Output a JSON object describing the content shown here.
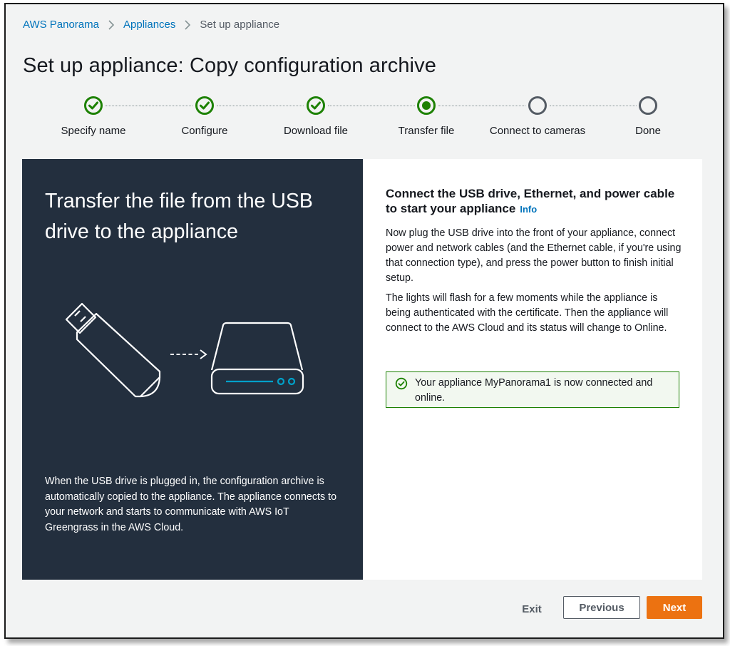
{
  "breadcrumb": {
    "items": [
      {
        "label": "AWS Panorama",
        "link": true
      },
      {
        "label": "Appliances",
        "link": true
      },
      {
        "label": "Set up appliance",
        "link": false
      }
    ],
    "separator_icon": "chevron-right-icon"
  },
  "page": {
    "title": "Set up appliance: Copy configuration archive"
  },
  "steps": [
    {
      "label": "Specify name",
      "status": "completed",
      "icon": "check-circle-icon"
    },
    {
      "label": "Configure",
      "status": "completed",
      "icon": "check-circle-icon"
    },
    {
      "label": "Download file",
      "status": "completed",
      "icon": "check-circle-icon"
    },
    {
      "label": "Transfer file",
      "status": "current",
      "icon": "current-step-icon"
    },
    {
      "label": "Connect to cameras",
      "status": "pending",
      "icon": "empty-circle-icon"
    },
    {
      "label": "Done",
      "status": "pending",
      "icon": "empty-circle-icon"
    }
  ],
  "left_panel": {
    "title": "Transfer the file from the USB drive to the appliance",
    "illustration_icons": [
      "usb-drive-icon",
      "arrow-right-icon",
      "appliance-icon"
    ],
    "description": "When the USB drive is plugged in, the configuration archive is automatically copied to the appliance. The appliance connects to your network and starts to communicate with AWS IoT Greengrass in the AWS Cloud."
  },
  "right_panel": {
    "heading": "Connect the USB drive, Ethernet, and power cable to start your appliance",
    "info_label": "Info",
    "paragraph1": "Now plug the USB drive into the front of your appliance, connect power and network cables (and the Ethernet cable, if you're using that connection type), and press the power button to finish initial setup.",
    "paragraph2": "The lights will flash for a few moments while the appliance is being authenticated with the certificate. Then the appliance will connect to the AWS Cloud and its status will change to Online.",
    "alert": {
      "type": "success",
      "icon": "success-check-icon",
      "text": "Your appliance MyPanorama1 is now connected and online."
    }
  },
  "footer": {
    "exit_label": "Exit",
    "previous_label": "Previous",
    "next_label": "Next"
  },
  "colors": {
    "link": "#0073bb",
    "success": "#1d8102",
    "pending": "#545b64",
    "dark_panel": "#232f3e",
    "primary_button": "#ec7211",
    "illustration_accent": "#00a1c9"
  }
}
